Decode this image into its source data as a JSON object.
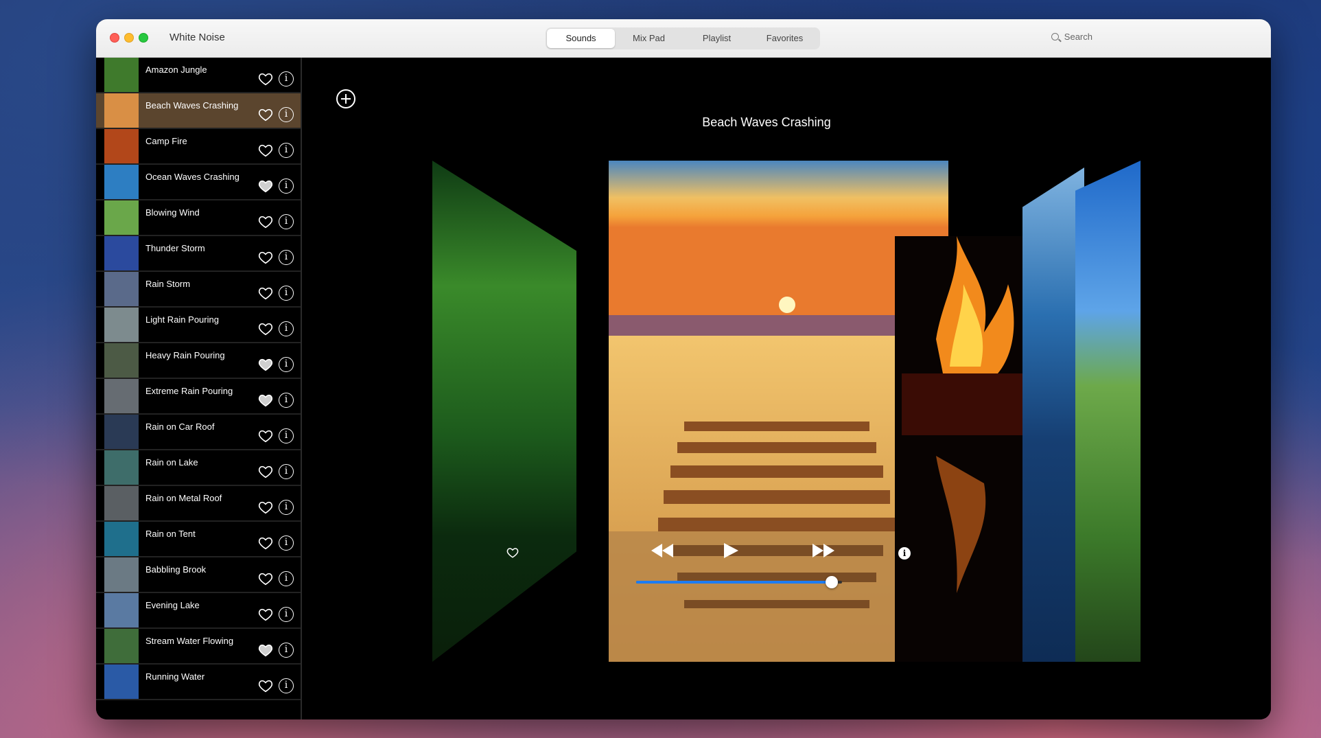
{
  "app": {
    "title": "White Noise"
  },
  "tabs": [
    {
      "label": "Sounds",
      "active": true
    },
    {
      "label": "Mix Pad",
      "active": false
    },
    {
      "label": "Playlist",
      "active": false
    },
    {
      "label": "Favorites",
      "active": false
    }
  ],
  "search": {
    "placeholder": "Search"
  },
  "sounds": [
    {
      "label": "Amazon Jungle",
      "favorite": false,
      "thumb": "#3f7a2c"
    },
    {
      "label": "Beach Waves Crashing",
      "favorite": false,
      "thumb": "#d98f45",
      "selected": true
    },
    {
      "label": "Camp Fire",
      "favorite": false,
      "thumb": "#b2471a"
    },
    {
      "label": "Ocean Waves Crashing",
      "favorite": true,
      "thumb": "#2d7ec2"
    },
    {
      "label": "Blowing Wind",
      "favorite": false,
      "thumb": "#6aa74a"
    },
    {
      "label": "Thunder Storm",
      "favorite": false,
      "thumb": "#2b4a9e"
    },
    {
      "label": "Rain Storm",
      "favorite": false,
      "thumb": "#5a6a8a"
    },
    {
      "label": "Light Rain Pouring",
      "favorite": false,
      "thumb": "#7d8b8e"
    },
    {
      "label": "Heavy Rain Pouring",
      "favorite": true,
      "thumb": "#4c5a45"
    },
    {
      "label": "Extreme Rain Pouring",
      "favorite": true,
      "thumb": "#666c72"
    },
    {
      "label": "Rain on Car Roof",
      "favorite": false,
      "thumb": "#2a3a55"
    },
    {
      "label": "Rain on Lake",
      "favorite": false,
      "thumb": "#3e6d6a"
    },
    {
      "label": "Rain on Metal Roof",
      "favorite": false,
      "thumb": "#5a5f63"
    },
    {
      "label": "Rain on Tent",
      "favorite": false,
      "thumb": "#1f6f8c"
    },
    {
      "label": "Babbling Brook",
      "favorite": false,
      "thumb": "#6b7a84"
    },
    {
      "label": "Evening Lake",
      "favorite": false,
      "thumb": "#5a7aa2"
    },
    {
      "label": "Stream Water Flowing",
      "favorite": true,
      "thumb": "#3f6d3a"
    },
    {
      "label": "Running Water",
      "favorite": false,
      "thumb": "#2a5aa6"
    }
  ],
  "player": {
    "now_playing": "Beach Waves Crashing",
    "progress": 0.95
  },
  "colors": {
    "accent": "#1d7cf2",
    "selected_row": "#5b452e"
  }
}
